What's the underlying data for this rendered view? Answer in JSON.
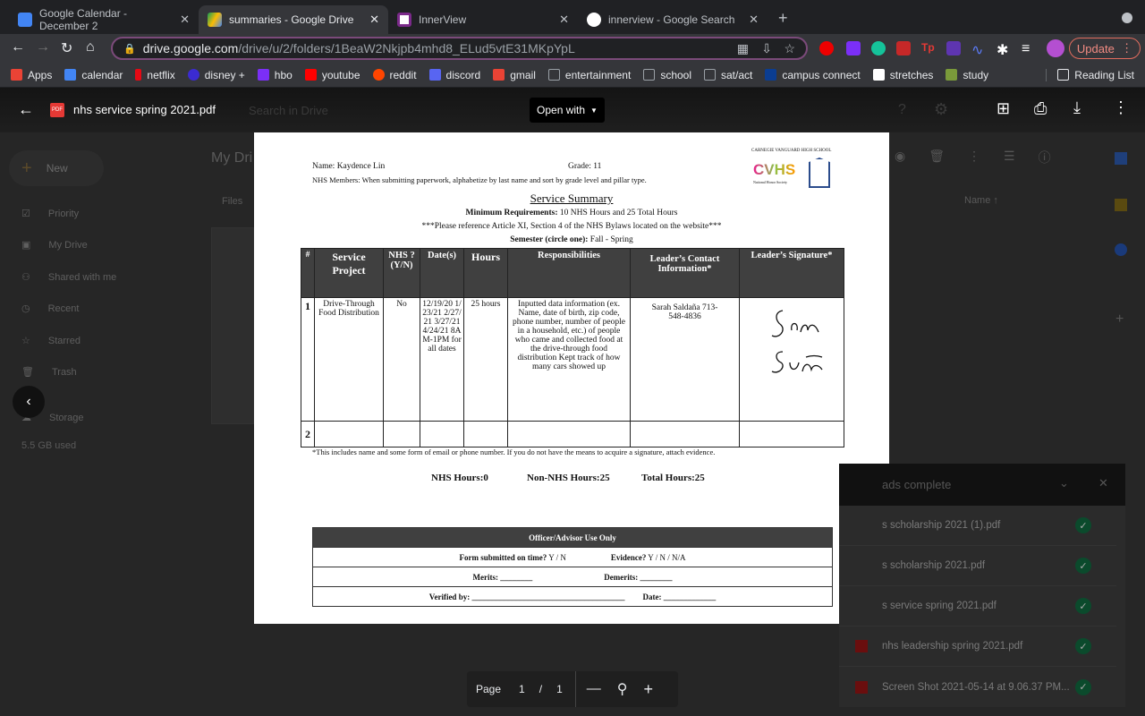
{
  "tabs": [
    {
      "title": "Google Calendar - December 2",
      "icon": "calendar-icon"
    },
    {
      "title": "summaries - Google Drive",
      "icon": "drive-icon",
      "active": true
    },
    {
      "title": "InnerView",
      "icon": "innerview-icon"
    },
    {
      "title": "innerview - Google Search",
      "icon": "google-icon"
    }
  ],
  "url": {
    "domain": "drive.google.com",
    "path": "/drive/u/2/folders/1BeaW2Nkjpb4mhd8_ELud5vtE31MKpYpL"
  },
  "update_label": "Update",
  "bookmarks": [
    {
      "label": "Apps",
      "color": "#ea4335"
    },
    {
      "label": "calendar",
      "color": "#4285f4"
    },
    {
      "label": "netflix",
      "color": "#e50914"
    },
    {
      "label": "disney +",
      "color": "#3b2bd1"
    },
    {
      "label": "hbo",
      "color": "#7b2ff7"
    },
    {
      "label": "youtube",
      "color": "#ff0000"
    },
    {
      "label": "reddit",
      "color": "#ff4500"
    },
    {
      "label": "discord",
      "color": "#5865f2"
    },
    {
      "label": "gmail",
      "color": "#ea4335"
    },
    {
      "label": "entertainment",
      "color": "#9aa0a6"
    },
    {
      "label": "school",
      "color": "#9aa0a6"
    },
    {
      "label": "sat/act",
      "color": "#9aa0a6"
    },
    {
      "label": "campus connect",
      "color": "#0b3d91"
    },
    {
      "label": "stretches",
      "color": "#ffffff"
    },
    {
      "label": "study",
      "color": "#7a9a3a"
    }
  ],
  "reading_list": "Reading List",
  "viewer": {
    "filename": "nhs service spring 2021.pdf",
    "open_with": "Open with",
    "search_placeholder": "Search in Drive"
  },
  "drive": {
    "new": "New",
    "nav": [
      "Priority",
      "My Drive",
      "Shared with me",
      "Recent",
      "Starred",
      "Trash"
    ],
    "storage": "Storage",
    "used": "5.5 GB used",
    "my_drive": "My Dri",
    "files": "Files",
    "name_col": "Name"
  },
  "doc": {
    "school": "CARNEGIE VANGUARD HIGH SCHOOL",
    "logo": "CVHS",
    "nhs": "National Honor Society",
    "name": "Name: Kaydence Lin",
    "grade": "Grade: 11",
    "instructions": "NHS Members: When submitting paperwork, alphabetize by last name and sort by grade level and pillar type.",
    "title": "Service Summary",
    "min_label": "Minimum Requirements:",
    "min_text": " 10 NHS Hours and 25 Total Hours",
    "reference": "***Please reference Article XI, Section 4 of the NHS Bylaws located on the website***",
    "semester_label": "Semester (circle one):",
    "semester_text": " Fall - Spring",
    "headers": [
      "#",
      "Service Project",
      "NHS ? (Y/N)",
      "Date(s)",
      "Hours",
      "Responsibilities",
      "Leader’s Contact Information*",
      "Leader’s Signature*"
    ],
    "rows": [
      {
        "num": "1",
        "project": "Drive-Through Food Distribution",
        "nhs": "No",
        "dates": "12/19/20 1/23/21 2/27/21 3/27/21 4/24/21 8AM-1PM for all dates",
        "hours": "25 hours",
        "resp": "Inputted data information (ex. Name, date of birth, zip code, phone number, number of people in a household, etc.) of people who came and collected food at the drive-through food distribution Kept track of how many cars showed up",
        "contact": "Sarah Saldaña 713-548-4836"
      },
      {
        "num": "2",
        "project": "",
        "nhs": "",
        "dates": "",
        "hours": "",
        "resp": "",
        "contact": ""
      }
    ],
    "footnote": "*This includes name and some form of email or phone number. If you do not have the means to acquire a signature, attach evidence.",
    "nhs_hours": "NHS Hours:0",
    "non_nhs_hours": "Non-NHS Hours:25",
    "total_hours": "Total Hours:25",
    "officer": {
      "title": "Officer/Advisor Use Only",
      "on_time": "Form submitted on time?",
      "on_time_opts": " Y  /  N",
      "evidence": "Evidence?",
      "evidence_opts": " Y  /  N  /  N/A",
      "merits": "Merits: ________",
      "demerits": "Demerits: ________",
      "verified": "Verified by: ______________________________________",
      "date": "Date: _____________"
    }
  },
  "downloads": {
    "title": "ads complete",
    "items": [
      "s scholarship 2021 (1).pdf",
      "s scholarship 2021.pdf",
      "s service spring 2021.pdf",
      "nhs leadership spring 2021.pdf",
      "Screen Shot 2021-05-14 at 9.06.37 PM..."
    ]
  },
  "pager": {
    "label": "Page",
    "current": "1",
    "sep": "/",
    "total": "1"
  }
}
